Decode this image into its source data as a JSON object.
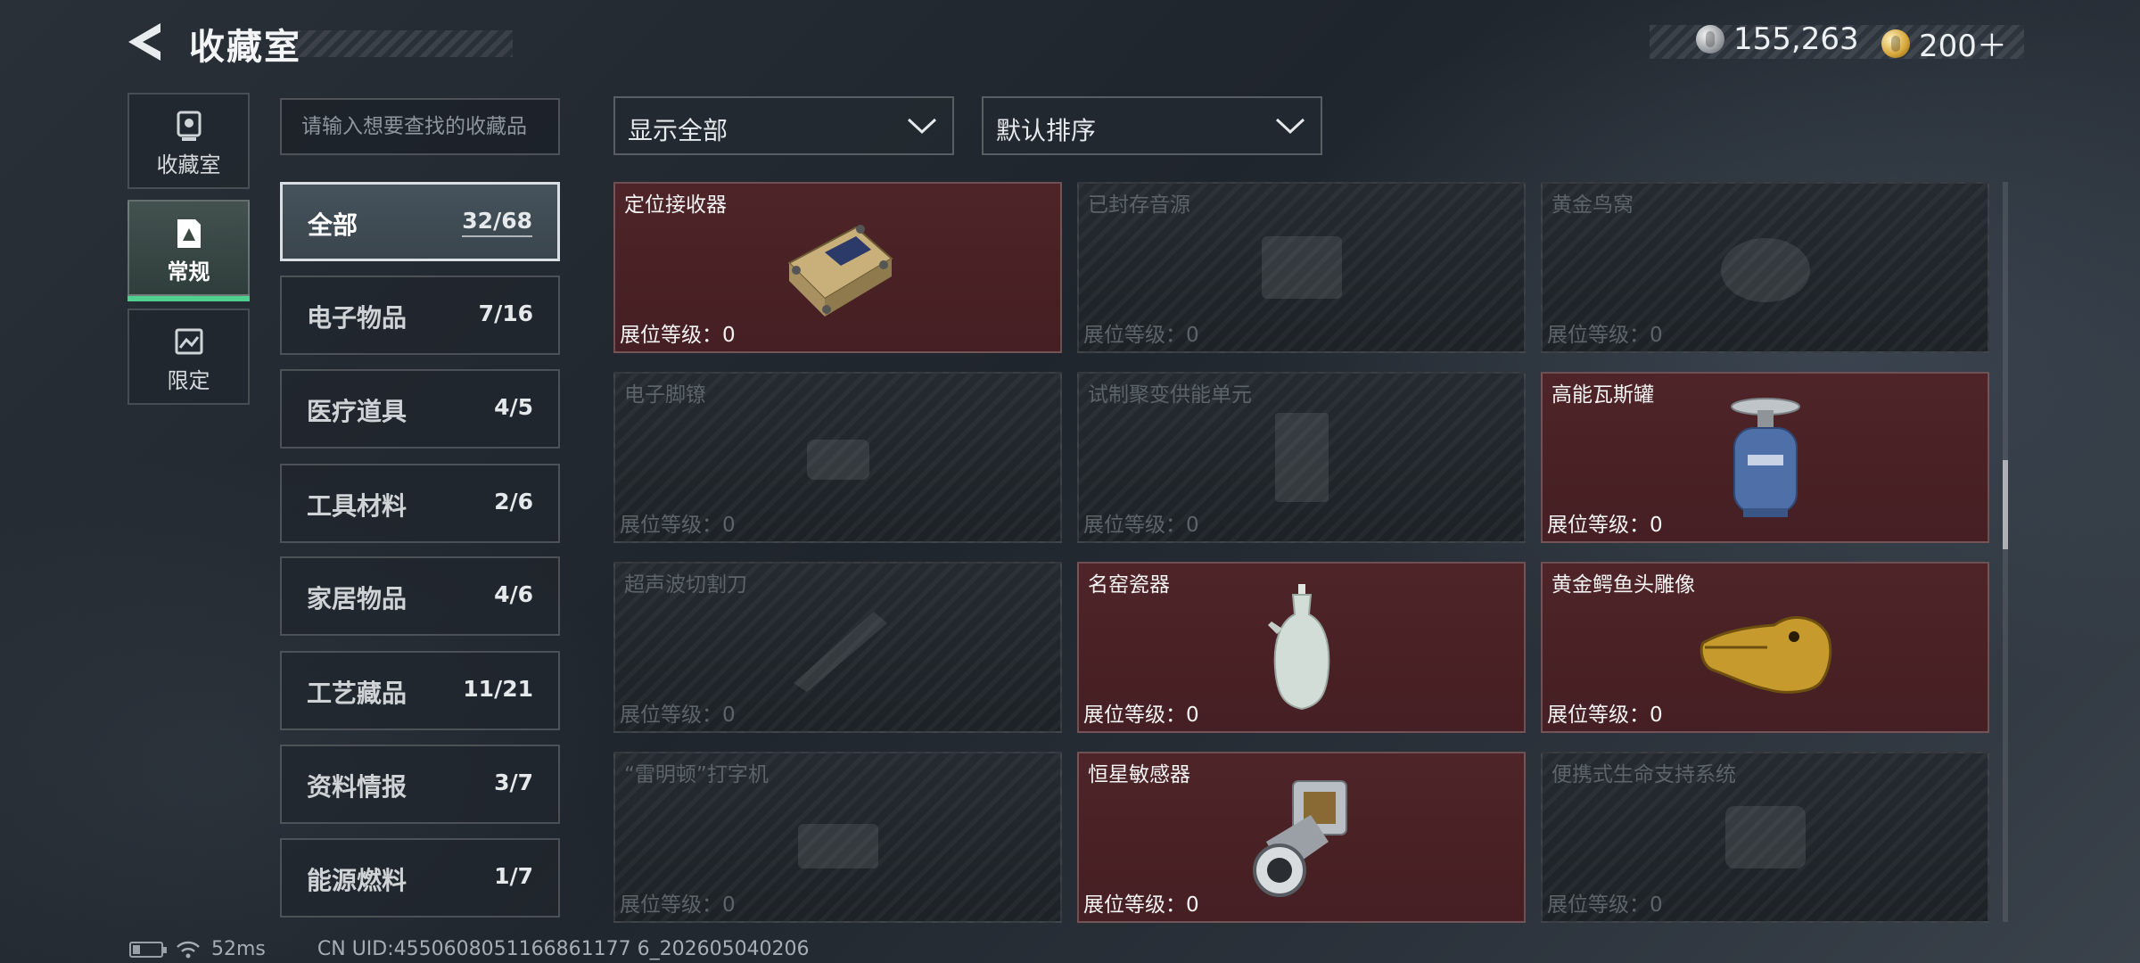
{
  "header": {
    "title": "收藏室",
    "currency": [
      {
        "icon": "silver-coin-icon",
        "value": "155,263"
      },
      {
        "icon": "gold-coin-icon",
        "value": "200＋"
      }
    ]
  },
  "nav": {
    "tabs": [
      {
        "label": "收藏室",
        "icon": "trophy-icon",
        "active": false
      },
      {
        "label": "常规",
        "icon": "document-icon",
        "active": true
      },
      {
        "label": "限定",
        "icon": "image-icon",
        "active": false
      }
    ]
  },
  "search": {
    "placeholder": "请输入想要查找的收藏品"
  },
  "categories": [
    {
      "label": "全部",
      "count": "32/68",
      "active": true
    },
    {
      "label": "电子物品",
      "count": "7/16"
    },
    {
      "label": "医疗道具",
      "count": "4/5"
    },
    {
      "label": "工具材料",
      "count": "2/6"
    },
    {
      "label": "家居物品",
      "count": "4/6"
    },
    {
      "label": "工艺藏品",
      "count": "11/21"
    },
    {
      "label": "资料情报",
      "count": "3/7"
    },
    {
      "label": "能源燃料",
      "count": "1/7"
    }
  ],
  "filters": {
    "display": "显示全部",
    "sort": "默认排序"
  },
  "items": [
    {
      "name": "定位接收器",
      "level": "展位等级：0",
      "owned": true,
      "icon": "receiver-icon"
    },
    {
      "name": "已封存音源",
      "level": "展位等级：0",
      "owned": false,
      "icon": "audio-icon"
    },
    {
      "name": "黄金鸟窝",
      "level": "展位等级：0",
      "owned": false,
      "icon": "nest-icon"
    },
    {
      "name": "电子脚镣",
      "level": "展位等级：0",
      "owned": false,
      "icon": "shackle-icon"
    },
    {
      "name": "试制聚变供能单元",
      "level": "展位等级：0",
      "owned": false,
      "icon": "fusion-cell-icon"
    },
    {
      "name": "高能瓦斯罐",
      "level": "展位等级：0",
      "owned": true,
      "icon": "gas-tank-icon"
    },
    {
      "name": "超声波切割刀",
      "level": "展位等级：0",
      "owned": false,
      "icon": "cutter-icon"
    },
    {
      "name": "名窑瓷器",
      "level": "展位等级：0",
      "owned": true,
      "icon": "porcelain-vase-icon"
    },
    {
      "name": "黄金鳄鱼头雕像",
      "level": "展位等级：0",
      "owned": true,
      "icon": "crocodile-statue-icon"
    },
    {
      "name": "“雷明顿”打字机",
      "level": "展位等级：0",
      "owned": false,
      "icon": "typewriter-icon"
    },
    {
      "name": "恒星敏感器",
      "level": "展位等级：0",
      "owned": true,
      "icon": "star-sensor-icon"
    },
    {
      "name": "便携式生命支持系统",
      "level": "展位等级：0",
      "owned": false,
      "icon": "life-support-icon"
    }
  ],
  "footer": {
    "ping": "52ms",
    "uid": "CN UID:4550608051166861177 6_202605040206"
  },
  "colors": {
    "owned_card": "#4e2428",
    "active_underline": "#4fd08f",
    "background": "#242a31"
  }
}
